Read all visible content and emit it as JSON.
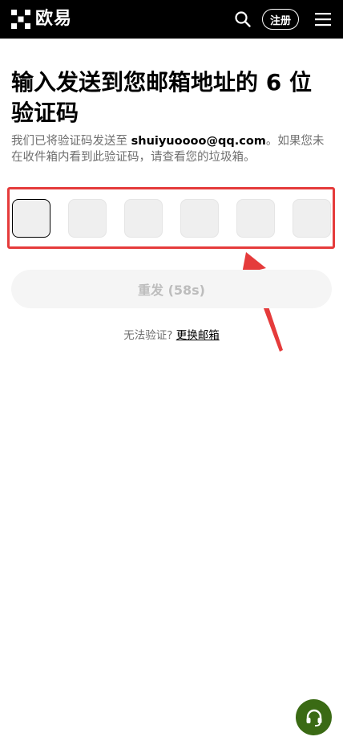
{
  "header": {
    "brand": "欧易",
    "register_label": "注册"
  },
  "title": "输入发送到您邮箱地址的 6 位验证码",
  "description": {
    "prefix": "我们已将验证码发送至 ",
    "email": "shuiyuoooo@qq.com",
    "suffix": "。如果您未在收件箱内看到此验证码，请查看您的垃圾箱。"
  },
  "code_inputs": [
    "",
    "",
    "",
    "",
    "",
    ""
  ],
  "resend_label": "重发 (58s)",
  "help": {
    "question": "无法验证?",
    "link": "更换邮箱"
  },
  "colors": {
    "highlight": "#e53b3b",
    "support": "#3a6a14"
  },
  "icons": [
    "okx-logo-icon",
    "search-icon",
    "menu-icon",
    "headset-icon"
  ]
}
